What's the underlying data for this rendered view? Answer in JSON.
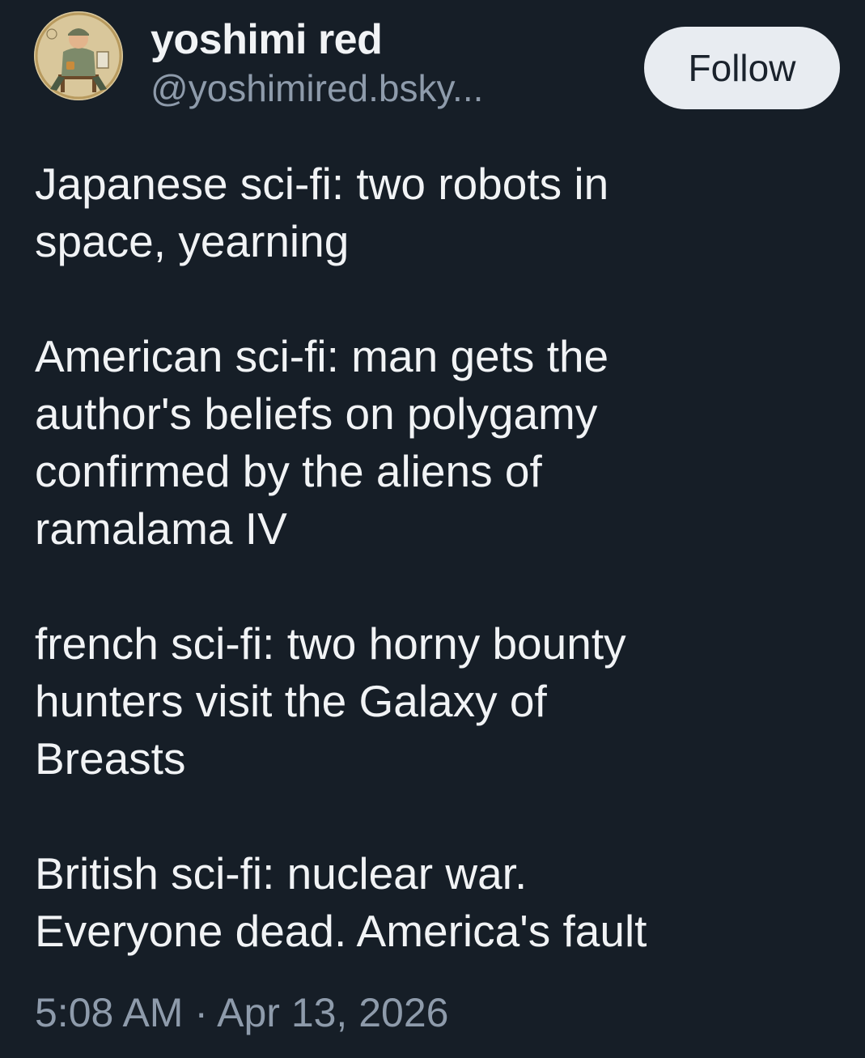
{
  "author": {
    "display_name": "yoshimi red",
    "handle": "@yoshimired.bsky...",
    "avatar_icon": "user-avatar-illustration"
  },
  "follow_button": {
    "label": "Follow"
  },
  "post": {
    "paragraphs": [
      "Japanese sci-fi: two robots in\nspace, yearning",
      "American sci-fi: man gets the\nauthor's beliefs on polygamy\nconfirmed by the aliens of\nramalama IV",
      "french sci-fi: two horny bounty\nhunters visit the Galaxy of\nBreasts",
      "British sci-fi: nuclear war.\nEveryone dead. America's fault"
    ],
    "timestamp": "5:08 AM · Apr 13, 2026"
  }
}
